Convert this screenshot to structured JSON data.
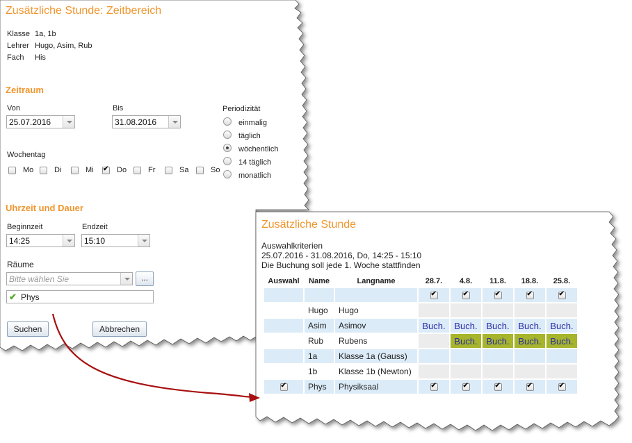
{
  "panel1": {
    "title": "Zusätzliche Stunde: Zeitbereich",
    "info": [
      {
        "label": "Klasse",
        "value": "1a, 1b"
      },
      {
        "label": "Lehrer",
        "value": "Hugo, Asim, Rub"
      },
      {
        "label": "Fach",
        "value": "His"
      }
    ],
    "zeitraum_heading": "Zeitraum",
    "von_label": "Von",
    "von_value": "25.07.2016",
    "bis_label": "Bis",
    "bis_value": "31.08.2016",
    "periodizitaet_label": "Periodizität",
    "periodizitaet_options": [
      {
        "label": "einmalig",
        "selected": false
      },
      {
        "label": "täglich",
        "selected": false
      },
      {
        "label": "wöchentlich",
        "selected": true
      },
      {
        "label": "14 täglich",
        "selected": false
      },
      {
        "label": "monatlich",
        "selected": false
      }
    ],
    "wochentag_label": "Wochentag",
    "wochentage": [
      {
        "label": "Mo",
        "checked": false
      },
      {
        "label": "Di",
        "checked": false
      },
      {
        "label": "Mi",
        "checked": false
      },
      {
        "label": "Do",
        "checked": true
      },
      {
        "label": "Fr",
        "checked": false
      },
      {
        "label": "Sa",
        "checked": false
      },
      {
        "label": "So",
        "checked": false
      }
    ],
    "uhrzeit_heading": "Uhrzeit und Dauer",
    "beginn_label": "Beginnzeit",
    "beginn_value": "14:25",
    "end_label": "Endzeit",
    "end_value": "15:10",
    "raeume_label": "Räume",
    "raeume_placeholder": "Bitte wählen Sie",
    "more_button": "...",
    "selected_room": "Phys",
    "search_button": "Suchen",
    "cancel_button": "Abbrechen"
  },
  "panel2": {
    "title": "Zusätzliche Stunde",
    "criteria_heading": "Auswahlkriterien",
    "criteria_line1": "25.07.2016 - 31.08.2016, Do, 14:25 - 15:10",
    "criteria_line2": "Die Buchung soll jede 1. Woche stattfinden",
    "columns": [
      "Auswahl",
      "Name",
      "Langname",
      "28.7.",
      "4.8.",
      "11.8.",
      "18.8.",
      "25.8."
    ],
    "booked_label": "Buch.",
    "rows": [
      {
        "band": true,
        "select": null,
        "name": "",
        "long": "",
        "cells": [
          "check",
          "check",
          "check",
          "check",
          "check"
        ]
      },
      {
        "band": false,
        "select": null,
        "name": "Hugo",
        "long": "Hugo",
        "cells": [
          "",
          "",
          "",
          "",
          ""
        ]
      },
      {
        "band": true,
        "select": null,
        "name": "Asim",
        "long": "Asimov",
        "cells": [
          "buch",
          "buch",
          "buch",
          "buch",
          "buch"
        ]
      },
      {
        "band": false,
        "select": null,
        "name": "Rub",
        "long": "Rubens",
        "cells": [
          "",
          "buch",
          "buch",
          "buch",
          "buch"
        ]
      },
      {
        "band": true,
        "select": null,
        "name": "1a",
        "long": "Klasse 1a (Gauss)",
        "cells": [
          "",
          "",
          "",
          "",
          ""
        ]
      },
      {
        "band": false,
        "select": null,
        "name": "1b",
        "long": "Klasse 1b (Newton)",
        "cells": [
          "",
          "",
          "",
          "",
          ""
        ]
      },
      {
        "band": true,
        "select": true,
        "name": "Phys",
        "long": "Physiksaal",
        "cells": [
          "check",
          "check",
          "check",
          "check",
          "check"
        ]
      }
    ]
  },
  "colors": {
    "accent": "#f0962e",
    "booked_bg": "#a6b52b",
    "booked_text": "#2b2aa6",
    "row_band": "#dcebf8",
    "arrow": "#a80f0f"
  }
}
